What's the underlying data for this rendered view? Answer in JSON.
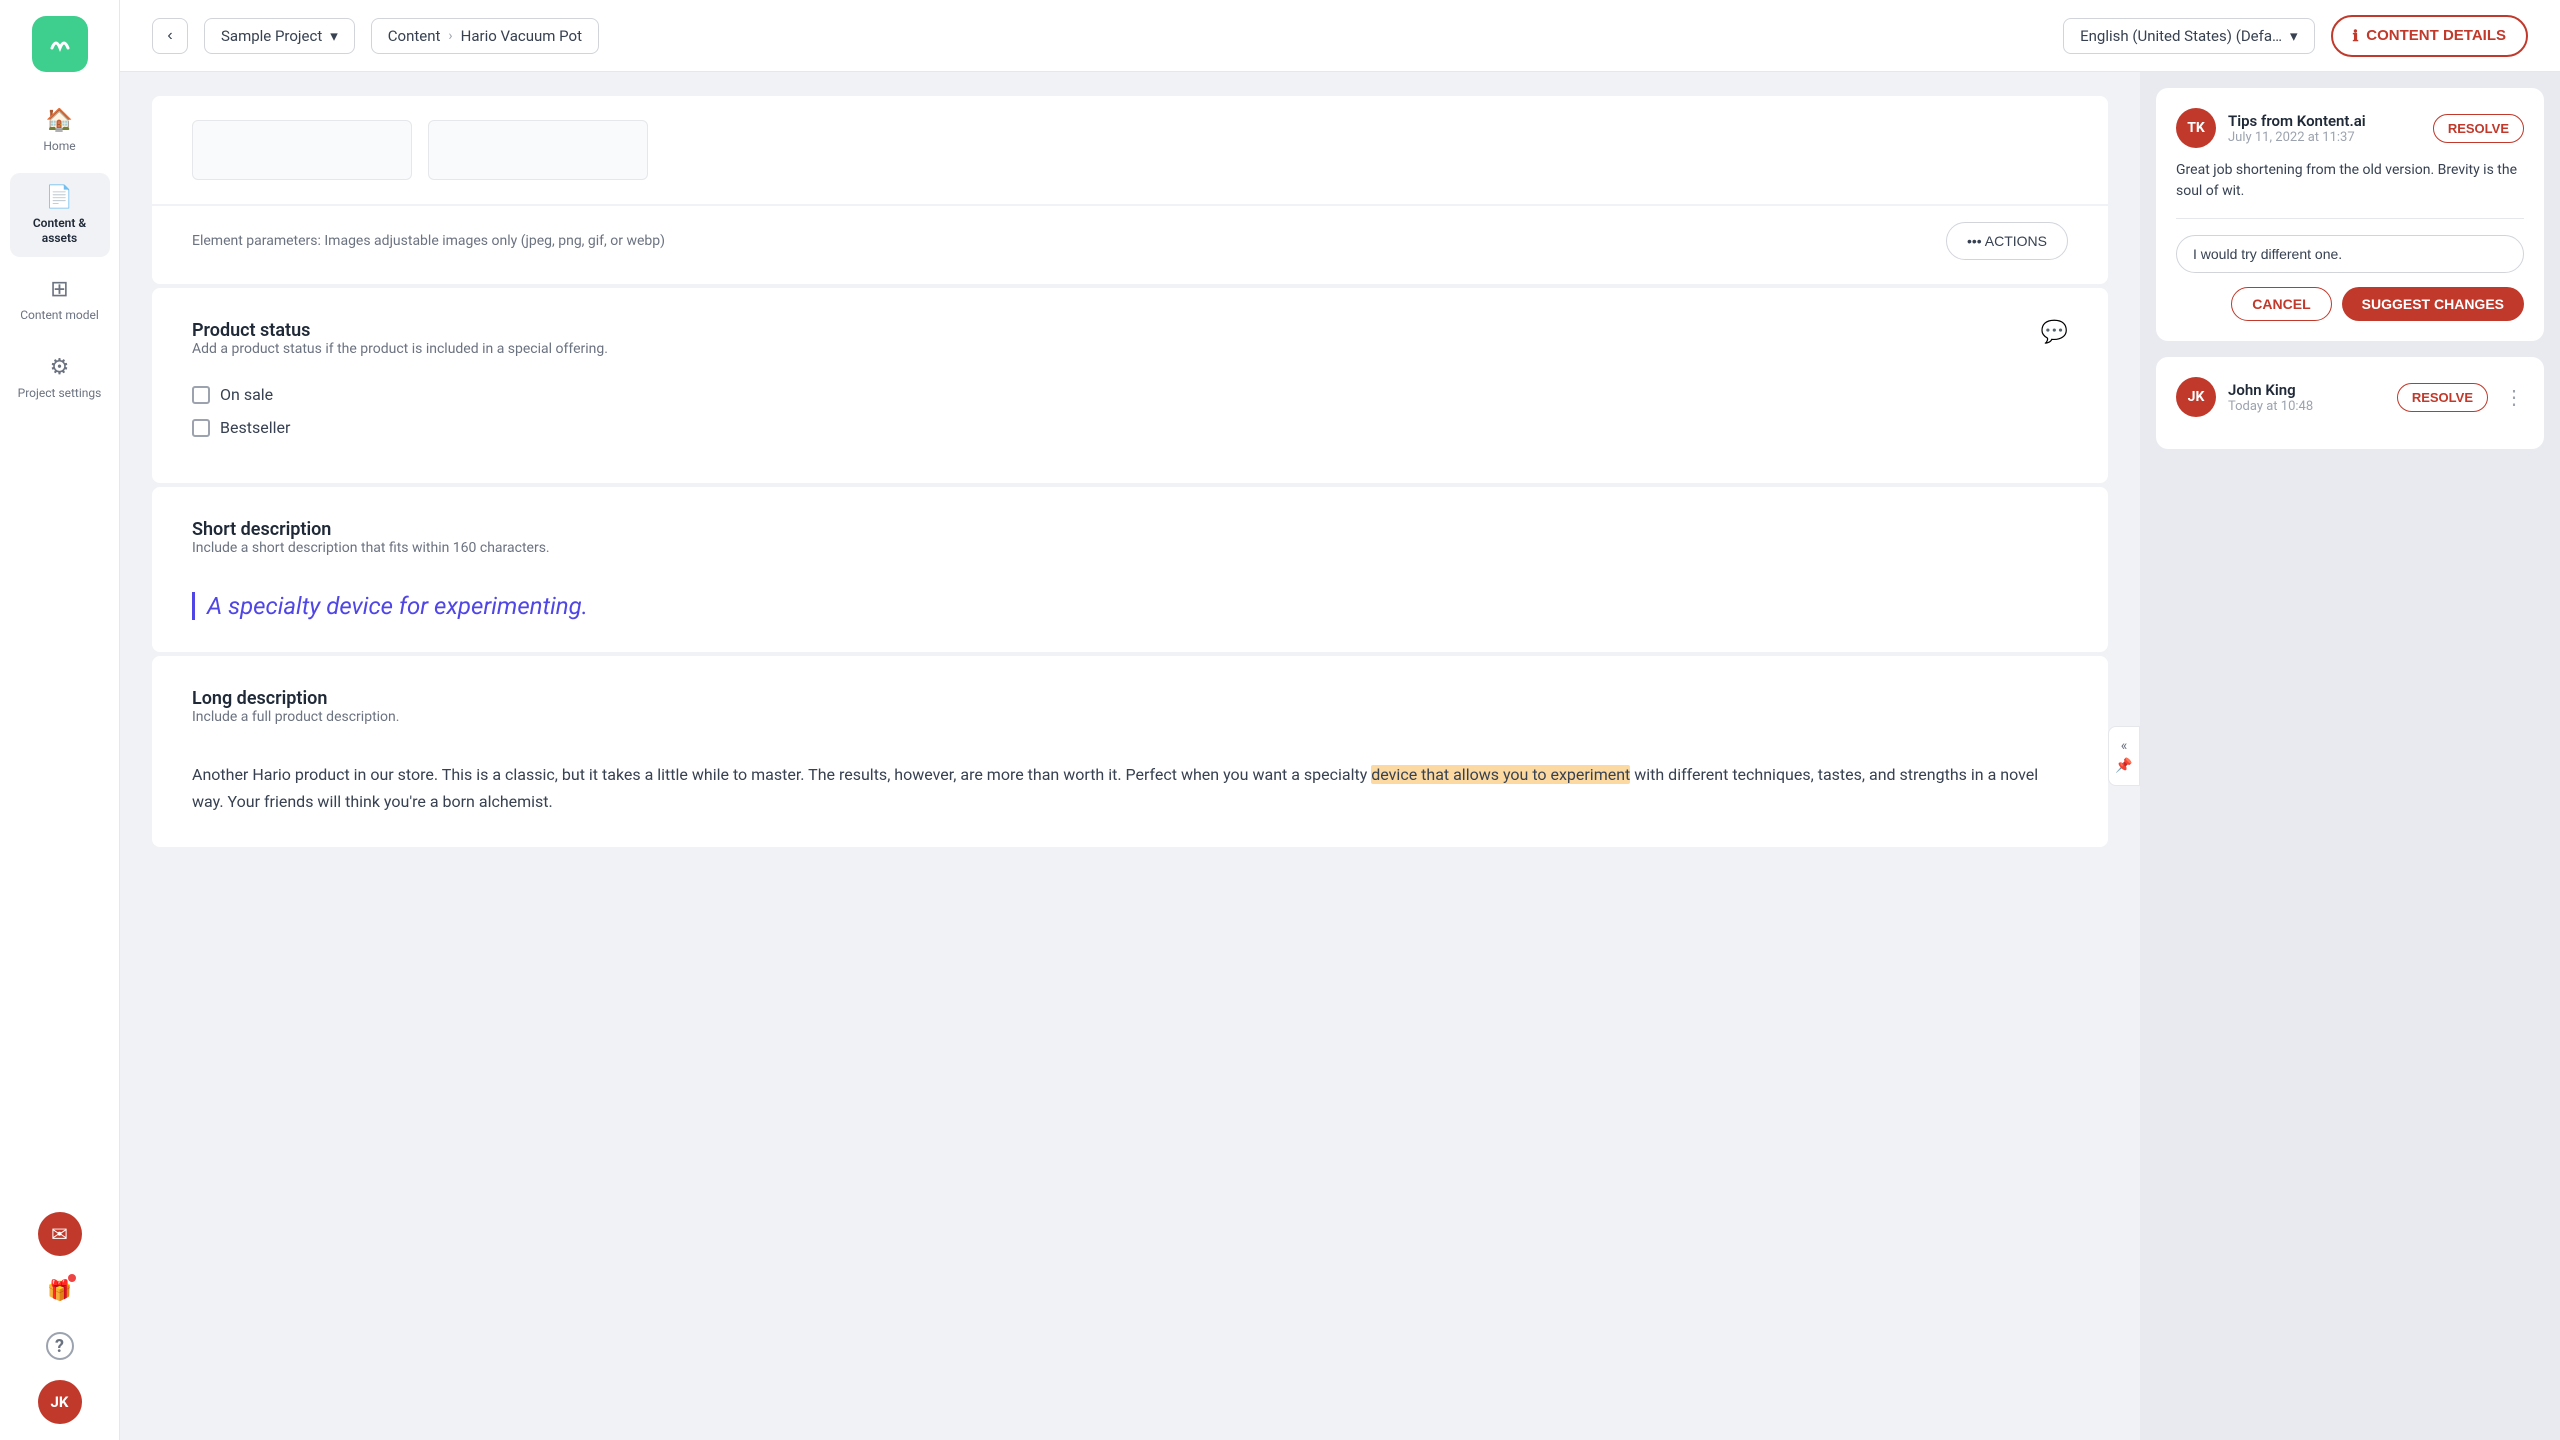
{
  "app": {
    "logo_initials": "M"
  },
  "sidebar": {
    "items": [
      {
        "id": "home",
        "label": "Home",
        "icon": "🏠",
        "active": false
      },
      {
        "id": "content-assets",
        "label": "Content & assets",
        "icon": "📄",
        "active": true
      },
      {
        "id": "content-model",
        "label": "Content model",
        "icon": "⊞",
        "active": false
      },
      {
        "id": "project-settings",
        "label": "Project settings",
        "icon": "⚙",
        "active": false
      }
    ],
    "bottom": {
      "messages_icon": "✉",
      "gift_icon": "🎁",
      "help_icon": "?",
      "avatar_initials": "JK"
    }
  },
  "header": {
    "back_label": "‹",
    "project_name": "Sample Project",
    "breadcrumb_separator": "›",
    "breadcrumb_section": "Content",
    "breadcrumb_page": "Hario Vacuum Pot",
    "language": "English (United States) (Defa…",
    "content_details_label": "CONTENT DETAILS",
    "content_details_icon": "ℹ"
  },
  "editor": {
    "element_params": "Element parameters: Images adjustable images only (jpeg, png, gif, or webp)",
    "actions_label": "••• ACTIONS",
    "product_status": {
      "title": "Product status",
      "subtitle": "Add a product status if the product is included in a special offering.",
      "checkboxes": [
        {
          "id": "on-sale",
          "label": "On sale",
          "checked": false
        },
        {
          "id": "bestseller",
          "label": "Bestseller",
          "checked": false
        }
      ]
    },
    "short_description": {
      "title": "Short description",
      "subtitle": "Include a short description that fits within 160 characters.",
      "value": "A specialty device for experimenting."
    },
    "long_description": {
      "title": "Long description",
      "subtitle": "Include a full product description.",
      "text_before": "Another Hario product in our store. This is a classic, but it takes a little while to master. The results, however, are more than worth it. Perfect when you want a specialty ",
      "text_highlight": "device that allows you to experiment",
      "text_after": " with different techniques, tastes, and strengths in a novel way. Your friends will think you're a born alchemist."
    }
  },
  "comments": [
    {
      "id": "tips-kontent",
      "avatar_initials": "TK",
      "avatar_bg": "#c0392b",
      "author": "Tips from Kontent.ai",
      "time": "July 11, 2022 at 11:37",
      "resolve_label": "RESOLVE",
      "body": "Great job shortening from the old version. Brevity is the soul of wit.",
      "reply_placeholder": "I would try different one.",
      "cancel_label": "CANCEL",
      "suggest_label": "SUGGEST CHANGES"
    },
    {
      "id": "john-king",
      "avatar_initials": "JK",
      "avatar_bg": "#c0392b",
      "author": "John King",
      "time": "Today at 10:48",
      "resolve_label": "RESOLVE",
      "body": "",
      "reply_placeholder": "",
      "cancel_label": "",
      "suggest_label": ""
    }
  ],
  "collapse_btn_label": "«",
  "pin_icon": "📌"
}
